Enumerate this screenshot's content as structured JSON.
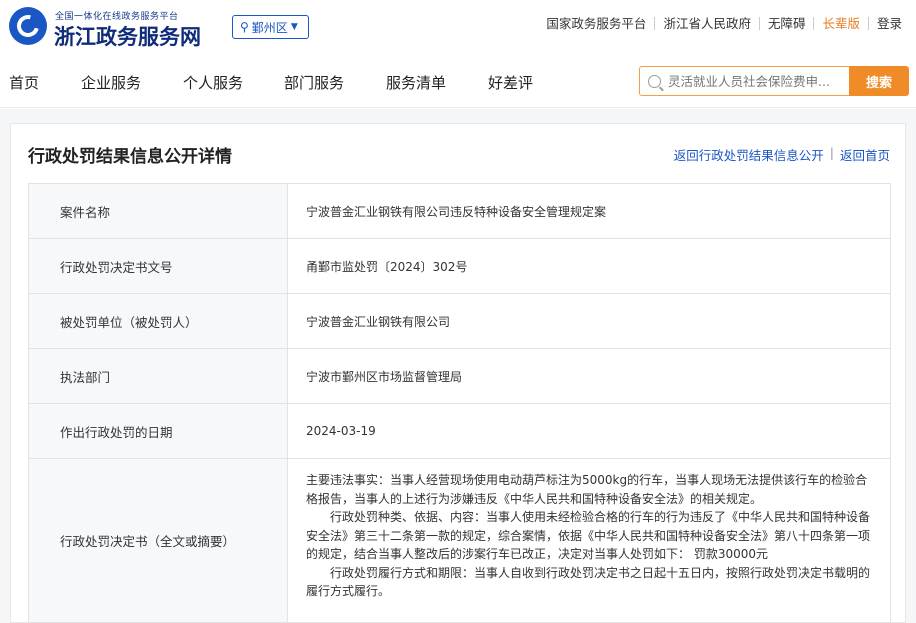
{
  "header": {
    "site_sub": "全国一体化在线政务服务平台",
    "site_name": "浙江政务服务网",
    "region": "鄞州区",
    "links": [
      "国家政务服务平台",
      "浙江省人民政府",
      "无障碍",
      "长辈版",
      "登录"
    ]
  },
  "nav": {
    "items": [
      "首页",
      "企业服务",
      "个人服务",
      "部门服务",
      "服务清单",
      "好差评"
    ],
    "search_placeholder": "灵活就业人员社会保险费申...",
    "search_button": "搜索"
  },
  "page": {
    "title": "行政处罚结果信息公开详情",
    "link_back_list": "返回行政处罚结果信息公开",
    "link_home": "返回首页",
    "link_sep": "|"
  },
  "rows": [
    {
      "label": "案件名称",
      "value": "宁波普金汇业钢铁有限公司违反特种设备安全管理规定案"
    },
    {
      "label": "行政处罚决定书文号",
      "value": "甬鄞市监处罚〔2024〕302号"
    },
    {
      "label": "被处罚单位（被处罚人）",
      "value": "宁波普金汇业钢铁有限公司"
    },
    {
      "label": "执法部门",
      "value": "宁波市鄞州区市场监督管理局"
    },
    {
      "label": "作出行政处罚的日期",
      "value": "2024-03-19"
    },
    {
      "label": "行政处罚决定书（全文或摘要）",
      "paragraphs": [
        "主要违法事实：当事人经营现场使用电动葫芦标注为5000kg的行车，当事人现场无法提供该行车的检验合格报告，当事人的上述行为涉嫌违反《中华人民共和国特种设备安全法》的相关规定。",
        "行政处罚种类、依据、内容：当事人使用未经检验合格的行车的行为违反了《中华人民共和国特种设备安全法》第三十二条第一款的规定，综合案情，依据《中华人民共和国特种设备安全法》第八十四条第一项的规定，结合当事人整改后的涉案行车已改正，决定对当事人处罚如下：   罚款30000元",
        "行政处罚履行方式和期限：当事人自收到行政处罚决定书之日起十五日内，按照行政处罚决定书载明的履行方式履行。"
      ]
    }
  ]
}
